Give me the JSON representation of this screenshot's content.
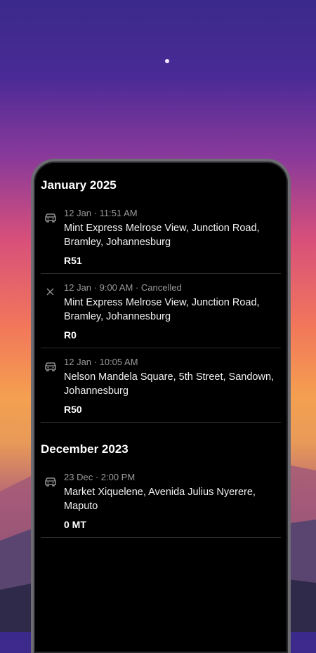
{
  "sections": [
    {
      "title": "January 2025",
      "trips": [
        {
          "icon": "car-icon",
          "date": "12 Jan",
          "time": "11:51 AM",
          "status": "",
          "address": "Mint Express Melrose View, Junction Road, Bramley, Johannesburg",
          "price": "R51"
        },
        {
          "icon": "cancelled-icon",
          "date": "12 Jan",
          "time": "9:00 AM",
          "status": "Cancelled",
          "address": "Mint Express Melrose View, Junction Road, Bramley, Johannesburg",
          "price": "R0"
        },
        {
          "icon": "car-icon",
          "date": "12 Jan",
          "time": "10:05 AM",
          "status": "",
          "address": "Nelson Mandela Square, 5th Street, Sandown, Johannesburg",
          "price": "R50"
        }
      ]
    },
    {
      "title": "December 2023",
      "trips": [
        {
          "icon": "car-icon",
          "date": "23 Dec",
          "time": "2:00 PM",
          "status": "",
          "address": "Market Xiquelene, Avenida Julius Nyerere, Maputo",
          "price": "0 MT"
        }
      ]
    }
  ],
  "colors": {
    "accent": "#ffffff",
    "muted": "#9a9a9a",
    "background": "#000000"
  }
}
